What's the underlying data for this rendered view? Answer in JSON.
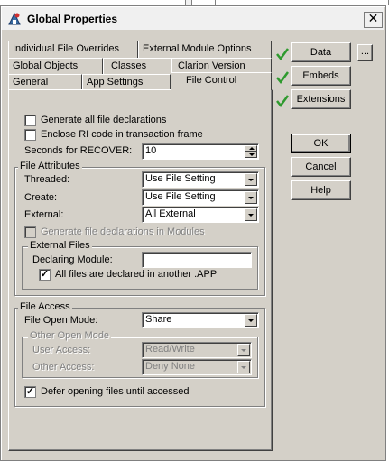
{
  "window": {
    "title": "Global Properties",
    "close_glyph": "✕"
  },
  "tabs": {
    "row1": [
      {
        "label": "Individual File Overrides",
        "key": "I"
      },
      {
        "label": "External Module Options",
        "key": "M"
      }
    ],
    "row2": [
      {
        "label": "Global Objects",
        "key": "O"
      },
      {
        "label": "Classes",
        "key": "C"
      },
      {
        "label": "Clarion Version",
        "key": "V"
      }
    ],
    "row3": [
      {
        "label": "General",
        "key": "G"
      },
      {
        "label": "App Settings",
        "key": "S"
      },
      {
        "label": "File Control",
        "key": "F",
        "active": true
      }
    ]
  },
  "file_control": {
    "generate_all": {
      "label": "Generate all file declarations",
      "checked": false
    },
    "enclose_ri": {
      "label": "Enclose RI code in transaction frame",
      "checked": false
    },
    "seconds_recover": {
      "label": "Seconds for RECOVER:",
      "value": "10"
    },
    "file_attributes": {
      "title": "File Attributes",
      "threaded": {
        "label": "Threaded:",
        "value": "Use File Setting"
      },
      "create": {
        "label": "Create:",
        "value": "Use File Setting"
      },
      "external": {
        "label": "External:",
        "value": "All External"
      },
      "generate_in_modules": {
        "label": "Generate file declarations in Modules",
        "checked": false,
        "disabled": true
      },
      "external_files": {
        "title": "External Files",
        "declaring_module": {
          "label": "Declaring Module:",
          "value": ""
        },
        "all_declared": {
          "label": "All files are declared in another .APP",
          "checked": true
        }
      }
    },
    "file_access": {
      "title": "File Access",
      "open_mode": {
        "label": "File Open Mode:",
        "value": "Share"
      },
      "other_open_mode": {
        "title": "Other Open Mode",
        "user_access": {
          "label": "User Access:",
          "value": "Read/Write"
        },
        "other_access": {
          "label": "Other Access:",
          "value": "Deny None"
        }
      },
      "defer_opening": {
        "label": "Defer opening files until accessed",
        "checked": true
      }
    }
  },
  "side_buttons": [
    {
      "label": "Data",
      "checked": true
    },
    {
      "label": "Embeds",
      "checked": true
    },
    {
      "label": "Extensions",
      "checked": true
    }
  ],
  "ellipsis_button": "...",
  "actions": {
    "ok": "OK",
    "cancel": "Cancel",
    "help": "Help"
  },
  "colors": {
    "dialog_face": "#d4d0c8",
    "check_green": "#2e9a2e"
  }
}
